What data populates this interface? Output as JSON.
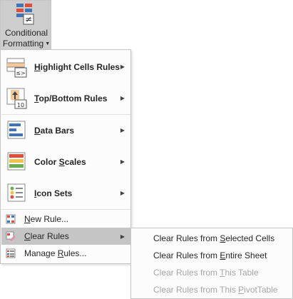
{
  "ribbon": {
    "button_line1": "Conditional",
    "button_line2": "Formatting",
    "button_icon": "conditional-formatting-icon"
  },
  "menu": {
    "items": [
      {
        "pre": "",
        "key": "H",
        "post": "ighlight Cells Rules",
        "icon": "highlight-cells-rules-icon",
        "has_submenu": true
      },
      {
        "pre": "",
        "key": "T",
        "post": "op/Bottom Rules",
        "icon": "top-bottom-rules-icon",
        "has_submenu": true
      },
      {
        "pre": "",
        "key": "D",
        "post": "ata Bars",
        "icon": "data-bars-icon",
        "has_submenu": true
      },
      {
        "pre": "Color ",
        "key": "S",
        "post": "cales",
        "icon": "color-scales-icon",
        "has_submenu": true
      },
      {
        "pre": "",
        "key": "I",
        "post": "con Sets",
        "icon": "icon-sets-icon",
        "has_submenu": true
      }
    ],
    "commands": [
      {
        "pre": "",
        "key": "N",
        "post": "ew Rule...",
        "icon": "new-rule-icon"
      },
      {
        "pre": "",
        "key": "C",
        "post": "lear Rules",
        "icon": "clear-rules-icon",
        "highlighted": true,
        "has_submenu": true
      },
      {
        "pre": "Manage ",
        "key": "R",
        "post": "ules...",
        "icon": "manage-rules-icon"
      }
    ]
  },
  "submenu": {
    "items": [
      {
        "pre": "Clear Rules from ",
        "key": "S",
        "post": "elected Cells",
        "enabled": true
      },
      {
        "pre": "Clear Rules from ",
        "key": "E",
        "post": "ntire Sheet",
        "enabled": true
      },
      {
        "pre": "Clear Rules from ",
        "key": "T",
        "post": "his Table",
        "enabled": false
      },
      {
        "pre": "Clear Rules from This ",
        "key": "P",
        "post": "ivotTable",
        "enabled": false
      }
    ]
  },
  "colors": {
    "highlight": "#c5c5c5",
    "disabled_text": "#a6a6a6",
    "menu_bg": "#fcfcfc"
  }
}
